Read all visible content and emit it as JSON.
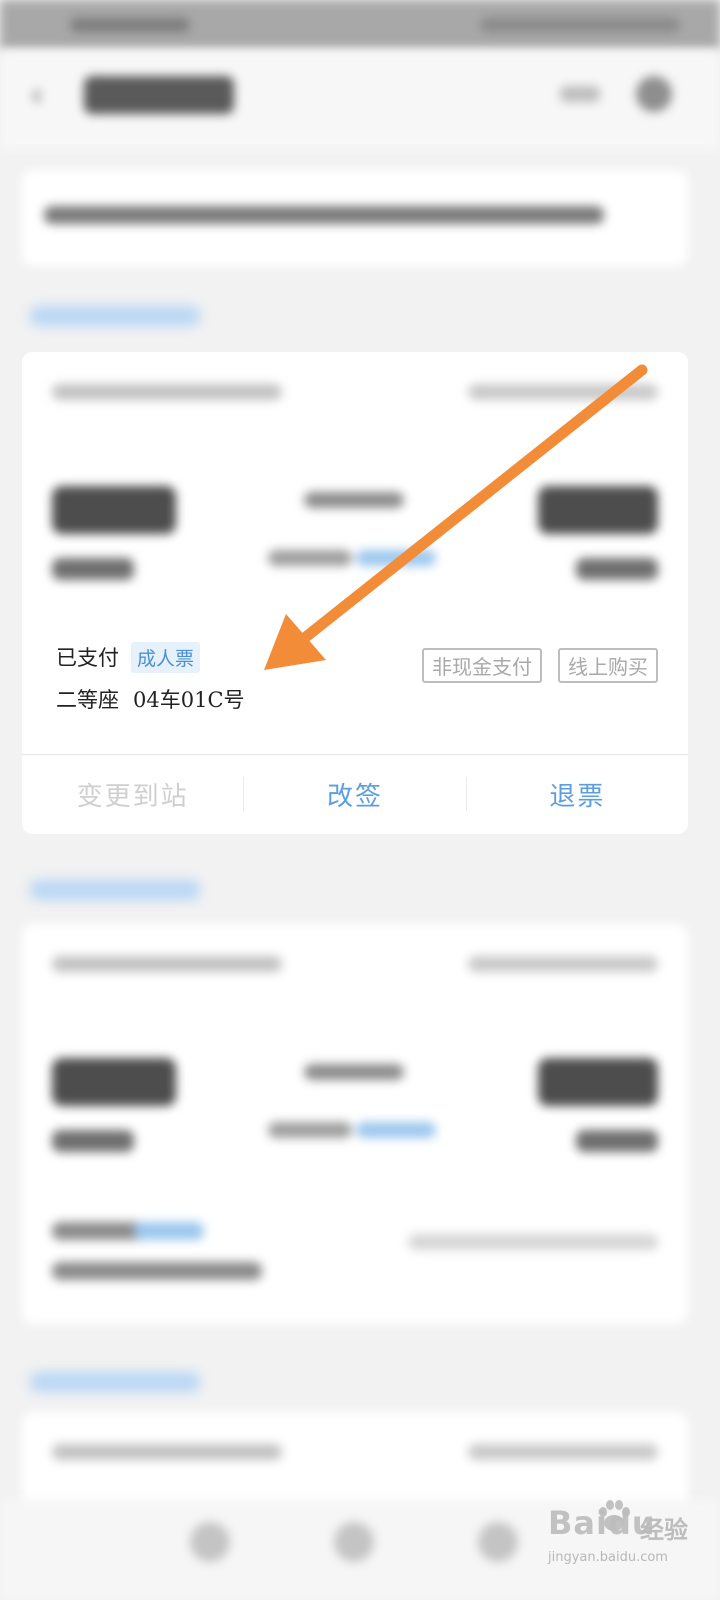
{
  "ticket": {
    "status": "已支付",
    "ticket_type": "成人票",
    "seat_class": "二等座",
    "seat_number": "04车01C号",
    "payment_tag": "非现金支付",
    "purchase_tag": "线上购买"
  },
  "actions": {
    "change_station": "变更到站",
    "rebook": "改签",
    "refund": "退票"
  },
  "colors": {
    "accent": "#5b9ee0",
    "arrow": "#f28c38"
  },
  "watermark": {
    "brand": "Baidu",
    "service": "经验",
    "url": "jingyan.baidu.com"
  }
}
